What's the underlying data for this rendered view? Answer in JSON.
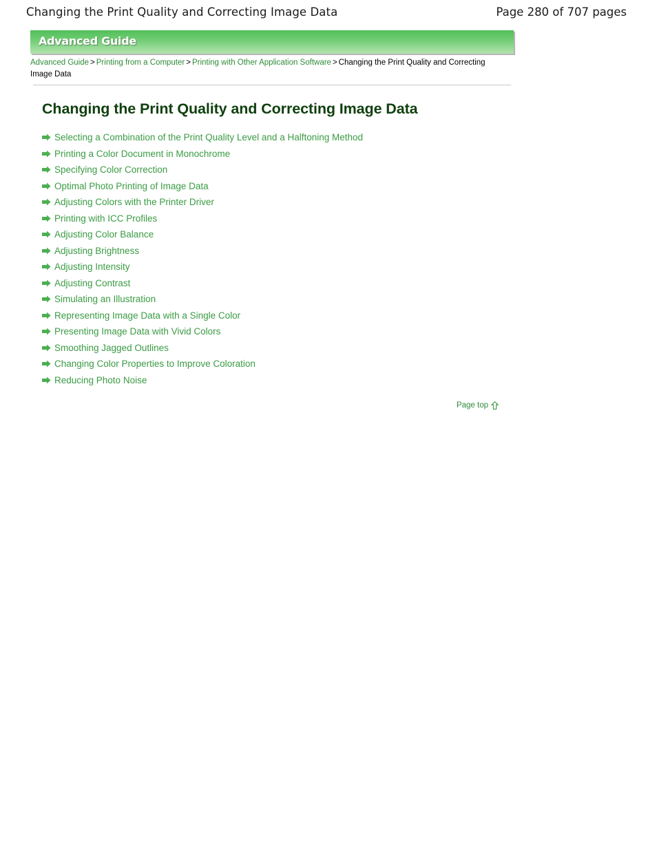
{
  "header": {
    "doc_title": "Changing the Print Quality and Correcting Image Data",
    "page_count": "Page 280 of 707 pages"
  },
  "banner": {
    "label": "Advanced Guide",
    "gradient_top": "#4fbd58",
    "gradient_bottom": "#b4e4ae"
  },
  "breadcrumb": {
    "separator": ">",
    "items": [
      {
        "label": "Advanced Guide",
        "link": true
      },
      {
        "label": "Printing from a Computer",
        "link": true
      },
      {
        "label": "Printing with Other Application Software",
        "link": true
      },
      {
        "label": "Changing the Print Quality and Correcting Image Data",
        "link": false
      }
    ]
  },
  "main": {
    "title": "Changing the Print Quality and Correcting Image Data",
    "title_color": "#10400f",
    "link_color": "#3a9b43",
    "arrow_icon": "arrow-right-icon",
    "links": [
      {
        "label": "Selecting a Combination of the Print Quality Level and a Halftoning Method"
      },
      {
        "label": "Printing a Color Document in Monochrome"
      },
      {
        "label": "Specifying Color Correction"
      },
      {
        "label": "Optimal Photo Printing of Image Data"
      },
      {
        "label": "Adjusting Colors with the Printer Driver"
      },
      {
        "label": "Printing with ICC Profiles"
      },
      {
        "label": "Adjusting Color Balance"
      },
      {
        "label": "Adjusting Brightness"
      },
      {
        "label": "Adjusting Intensity"
      },
      {
        "label": "Adjusting Contrast"
      },
      {
        "label": "Simulating an Illustration"
      },
      {
        "label": "Representing Image Data with a Single Color"
      },
      {
        "label": "Presenting Image Data with Vivid Colors"
      },
      {
        "label": "Smoothing Jagged Outlines"
      },
      {
        "label": "Changing Color Properties to Improve Coloration"
      },
      {
        "label": "Reducing Photo Noise"
      }
    ]
  },
  "footer": {
    "page_top_label": "Page top",
    "page_top_icon": "arrow-up-icon"
  }
}
